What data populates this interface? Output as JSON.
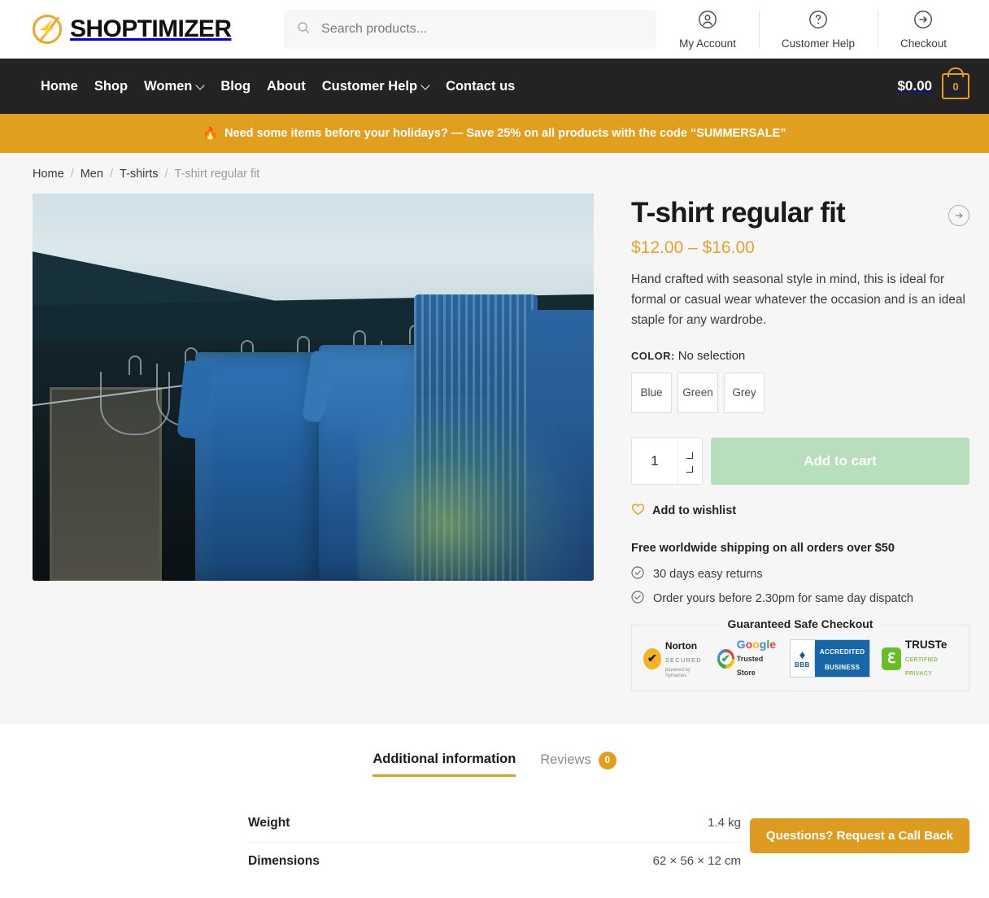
{
  "header": {
    "logo_text": "SHOPTIMIZER",
    "search": {
      "placeholder": "Search products...",
      "value": ""
    },
    "links": [
      {
        "label": "My Account",
        "icon": "user-circle-icon"
      },
      {
        "label": "Customer Help",
        "icon": "question-circle-icon"
      },
      {
        "label": "Checkout",
        "icon": "arrow-right-circle-icon"
      }
    ]
  },
  "nav": {
    "items": [
      {
        "label": "Home",
        "has_caret": false
      },
      {
        "label": "Shop",
        "has_caret": false
      },
      {
        "label": "Women",
        "has_caret": true
      },
      {
        "label": "Blog",
        "has_caret": false
      },
      {
        "label": "About",
        "has_caret": false
      },
      {
        "label": "Customer Help",
        "has_caret": true
      },
      {
        "label": "Contact us",
        "has_caret": false
      }
    ],
    "cart": {
      "total": "$0.00",
      "count": "0"
    }
  },
  "promo": {
    "icon": "fire-emoji",
    "emoji": "🔥",
    "text": "Need some items before your holidays? — Save 25% on all products with the code “SUMMERSALE”"
  },
  "breadcrumb": {
    "items": [
      "Home",
      "Men",
      "T-shirts"
    ],
    "current": "T-shirt regular fit",
    "separator": "/"
  },
  "product": {
    "title": "T-shirt regular fit",
    "price": "$12.00 – $16.00",
    "description": "Hand crafted with seasonal style in mind, this is ideal for formal or casual wear whatever the occasion and is an ideal staple for any wardrobe.",
    "attribute": {
      "label": "COLOR:",
      "selection": "No selection",
      "options": [
        "Blue",
        "Green",
        "Grey"
      ]
    },
    "quantity": "1",
    "add_to_cart_label": "Add to cart",
    "wishlist_label": "Add to wishlist",
    "shipping_note": "Free worldwide shipping on all orders over $50",
    "features": [
      "30 days easy returns",
      "Order yours before 2.30pm for same day dispatch"
    ],
    "safe_checkout": {
      "legend": "Guaranteed Safe Checkout",
      "badges": [
        {
          "name": "Norton",
          "main": "Norton",
          "sub": "SECURED",
          "powered": "powered by Symantec"
        },
        {
          "name": "Google",
          "main": "Google",
          "sub": "Trusted Store"
        },
        {
          "name": "BBB",
          "abbr": "BBB",
          "line1": "ACCREDITED",
          "line2": "BUSINESS"
        },
        {
          "name": "TRUSTe",
          "main": "TRUSTe",
          "sub": "CERTIFIED PRIVACY"
        }
      ]
    }
  },
  "tabs": [
    {
      "label": "Additional information",
      "active": true,
      "badge": null
    },
    {
      "label": "Reviews",
      "active": false,
      "badge": "0"
    }
  ],
  "additional_information": {
    "rows": [
      {
        "label": "Weight",
        "value": "1.4 kg"
      },
      {
        "label": "Dimensions",
        "value": "62 × 56 × 12 cm"
      }
    ]
  },
  "callback_button": {
    "label": "Questions? Request a Call Back"
  },
  "colors": {
    "accent": "#e0a01e",
    "nav_bg": "#232323",
    "price": "#e5a32d",
    "add_to_cart_bg": "#b8dfbc",
    "section_bg": "#f6f6f6"
  }
}
